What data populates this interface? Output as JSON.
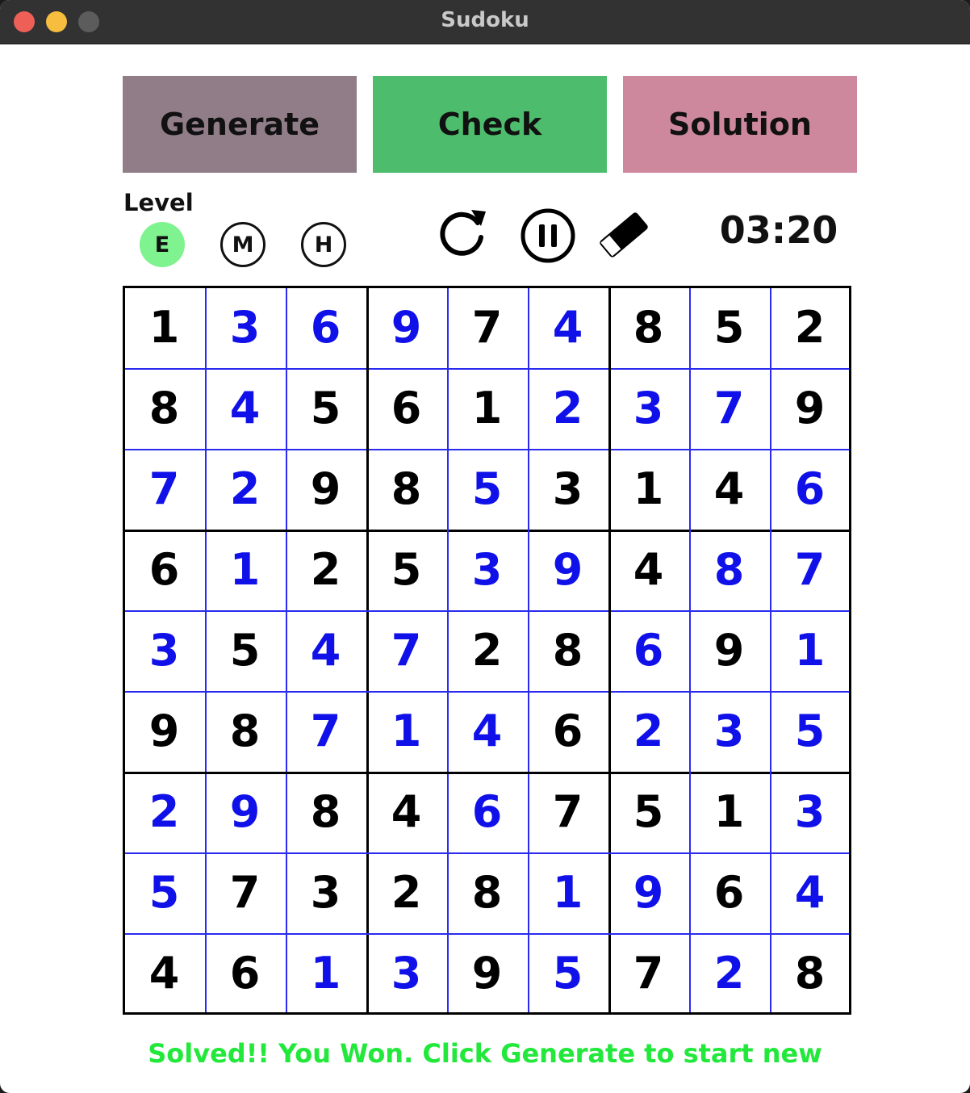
{
  "window": {
    "title": "Sudoku"
  },
  "toolbar": {
    "generate_label": "Generate",
    "check_label": "Check",
    "solution_label": "Solution"
  },
  "level": {
    "label": "Level",
    "options": [
      "E",
      "M",
      "H"
    ],
    "selected": "E"
  },
  "controls": {
    "restart_icon": "restart-icon",
    "pause_icon": "pause-icon",
    "eraser_icon": "eraser-icon"
  },
  "timer": "03:20",
  "board": {
    "values": [
      [
        1,
        3,
        6,
        9,
        7,
        4,
        8,
        5,
        2
      ],
      [
        8,
        4,
        5,
        6,
        1,
        2,
        3,
        7,
        9
      ],
      [
        7,
        2,
        9,
        8,
        5,
        3,
        1,
        4,
        6
      ],
      [
        6,
        1,
        2,
        5,
        3,
        9,
        4,
        8,
        7
      ],
      [
        3,
        5,
        4,
        7,
        2,
        8,
        6,
        9,
        1
      ],
      [
        9,
        8,
        7,
        1,
        4,
        6,
        2,
        3,
        5
      ],
      [
        2,
        9,
        8,
        4,
        6,
        7,
        5,
        1,
        3
      ],
      [
        5,
        7,
        3,
        2,
        8,
        1,
        9,
        6,
        4
      ],
      [
        4,
        6,
        1,
        3,
        9,
        5,
        7,
        2,
        8
      ]
    ],
    "entered": [
      [
        0,
        1,
        1,
        1,
        0,
        1,
        0,
        0,
        0
      ],
      [
        0,
        1,
        0,
        0,
        0,
        1,
        1,
        1,
        0
      ],
      [
        1,
        1,
        0,
        0,
        1,
        0,
        0,
        0,
        1
      ],
      [
        0,
        1,
        0,
        0,
        1,
        1,
        0,
        1,
        1
      ],
      [
        1,
        0,
        1,
        1,
        0,
        0,
        1,
        0,
        1
      ],
      [
        0,
        0,
        1,
        1,
        1,
        0,
        1,
        1,
        1
      ],
      [
        1,
        1,
        0,
        0,
        1,
        0,
        0,
        0,
        1
      ],
      [
        1,
        0,
        0,
        0,
        0,
        1,
        1,
        0,
        1
      ],
      [
        0,
        0,
        1,
        1,
        0,
        1,
        0,
        1,
        0
      ]
    ]
  },
  "status": "Solved!! You Won. Click Generate to start new",
  "colors": {
    "given": "#000000",
    "entered": "#1010e8",
    "grid_thin": "#2a2af0",
    "grid_thick": "#000000",
    "status": "#22e83b",
    "level_selected": "#7ef38f"
  }
}
